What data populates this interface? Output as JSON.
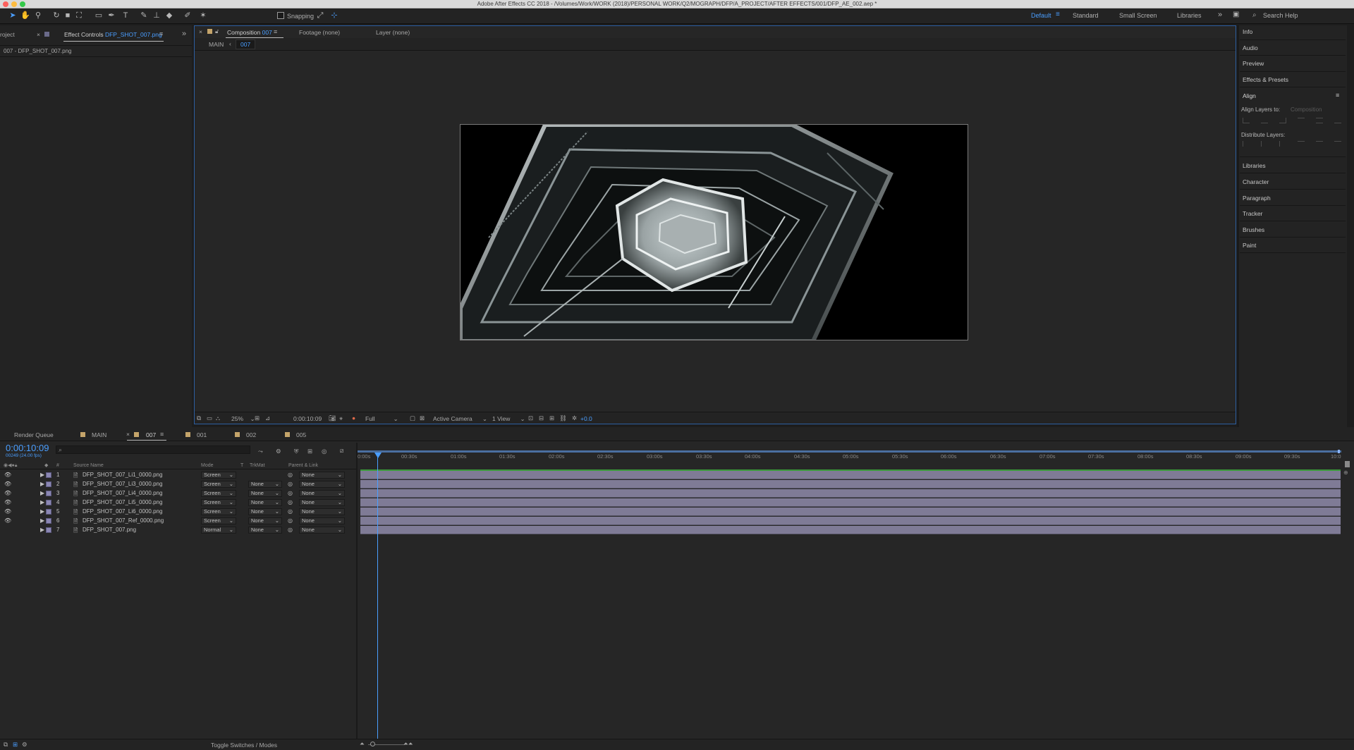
{
  "window_title": "Adobe After Effects CC 2018 - /Volumes/Work/WORK (2018)/PERSONAL WORK/Q2/MOGRAPH/DFP/A_PROJECT/AFTER EFFECTS/001/DFP_AE_002.aep *",
  "toolbar": {
    "snapping_label": "Snapping",
    "workspaces": [
      "Default",
      "Standard",
      "Small Screen",
      "Libraries"
    ],
    "active_workspace": "Default",
    "search_placeholder": "Search Help"
  },
  "left_panel": {
    "project_tab": "roject",
    "effect_controls_tab": "Effect Controls",
    "effect_controls_layer": "DFP_SHOT_007.png",
    "effect_path": "007 - DFP_SHOT_007.png"
  },
  "comp_panel": {
    "tab_prefix": "Composition",
    "tab_comp": "007",
    "footage_tab": "Footage (none)",
    "layer_tab": "Layer (none)",
    "breadcrumb_parent": "MAIN",
    "breadcrumb_current": "007",
    "footer": {
      "zoom": "25%",
      "timecode": "0:00:10:09",
      "resolution": "Full",
      "camera": "Active Camera",
      "views": "1 View",
      "exposure": "+0.0"
    }
  },
  "right_panel": {
    "items": [
      "Info",
      "Audio",
      "Preview",
      "Effects & Presets",
      "Align"
    ],
    "align_layers_to_label": "Align Layers to:",
    "align_layers_to_value": "Composition",
    "distribute_label": "Distribute Layers:",
    "items_lower": [
      "Libraries",
      "Character",
      "Paragraph",
      "Tracker",
      "Brushes",
      "Paint"
    ]
  },
  "timeline": {
    "tabs": [
      "Render Queue",
      "MAIN",
      "007",
      "001",
      "002",
      "005"
    ],
    "active_tab": "007",
    "current_time": "0:00:10:09",
    "frame_info": "00249 (24.00 fps)",
    "columns": {
      "hash": "#",
      "source_name": "Source Name",
      "mode": "Mode",
      "t": "T",
      "trkmat": "TrkMat",
      "parent": "Parent & Link"
    },
    "layers": [
      {
        "num": "1",
        "name": "DFP_SHOT_007_Li1_0000.png",
        "mode": "Screen",
        "trkmat": "",
        "parent": "None"
      },
      {
        "num": "2",
        "name": "DFP_SHOT_007_Li3_0000.png",
        "mode": "Screen",
        "trkmat": "None",
        "parent": "None"
      },
      {
        "num": "3",
        "name": "DFP_SHOT_007_Li4_0000.png",
        "mode": "Screen",
        "trkmat": "None",
        "parent": "None"
      },
      {
        "num": "4",
        "name": "DFP_SHOT_007_Li5_0000.png",
        "mode": "Screen",
        "trkmat": "None",
        "parent": "None"
      },
      {
        "num": "5",
        "name": "DFP_SHOT_007_Li6_0000.png",
        "mode": "Screen",
        "trkmat": "None",
        "parent": "None"
      },
      {
        "num": "6",
        "name": "DFP_SHOT_007_Ref_0000.png",
        "mode": "Screen",
        "trkmat": "None",
        "parent": "None"
      },
      {
        "num": "7",
        "name": "DFP_SHOT_007.png",
        "mode": "Normal",
        "trkmat": "None",
        "parent": "None"
      }
    ],
    "ruler": [
      "0:00s",
      "00:30s",
      "01:00s",
      "01:30s",
      "02:00s",
      "02:30s",
      "03:00s",
      "03:30s",
      "04:00s",
      "04:30s",
      "05:00s",
      "05:30s",
      "06:00s",
      "06:30s",
      "07:00s",
      "07:30s",
      "08:00s",
      "08:30s",
      "09:00s",
      "09:30s",
      "10:0"
    ],
    "toggle_label": "Toggle Switches / Modes"
  },
  "colors": {
    "accent_blue": "#4a9eff",
    "layer_bar": "#7f7b96",
    "label_purple": "#8b87b3",
    "work_area_green": "#3a9a3a",
    "comp_label_tan": "#c4a46a"
  }
}
